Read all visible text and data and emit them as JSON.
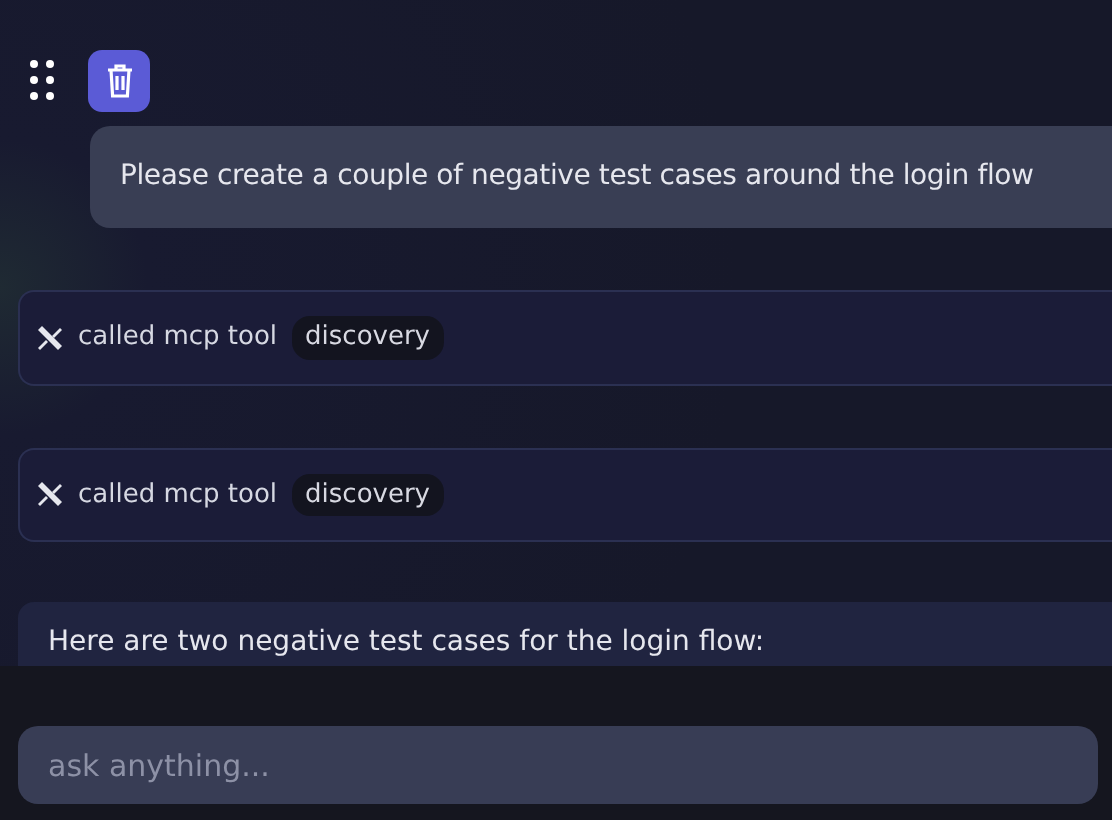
{
  "toolbar": {
    "buttons": [
      {
        "kind": "drag"
      },
      {
        "kind": "delete"
      }
    ]
  },
  "messages": [
    {
      "kind": "user",
      "text": "Please create a couple of negative test cases around the login flow"
    },
    {
      "kind": "tool",
      "label": "called mcp tool",
      "tool": "discovery"
    },
    {
      "kind": "tool",
      "label": "called mcp tool",
      "tool": "discovery"
    },
    {
      "kind": "assistant",
      "text": "Here are two negative test cases for the login flow:"
    }
  ],
  "input": {
    "placeholder": "ask anything..."
  }
}
